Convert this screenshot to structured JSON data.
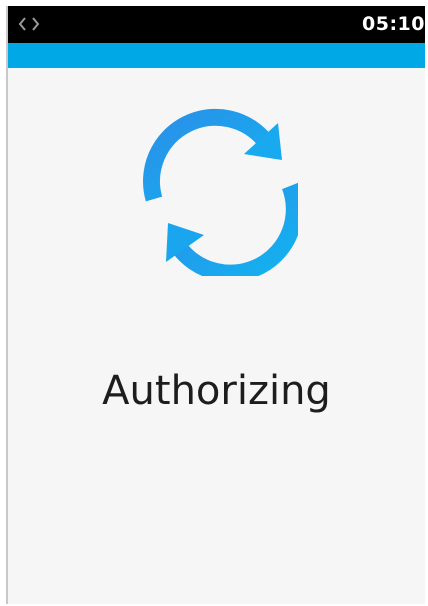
{
  "status_bar": {
    "time": "05:10",
    "connection_icon": "double-arrow-icon"
  },
  "accent_color": "#00a8e6",
  "main": {
    "status_icon": "sync-icon",
    "status_text": "Authorizing"
  }
}
